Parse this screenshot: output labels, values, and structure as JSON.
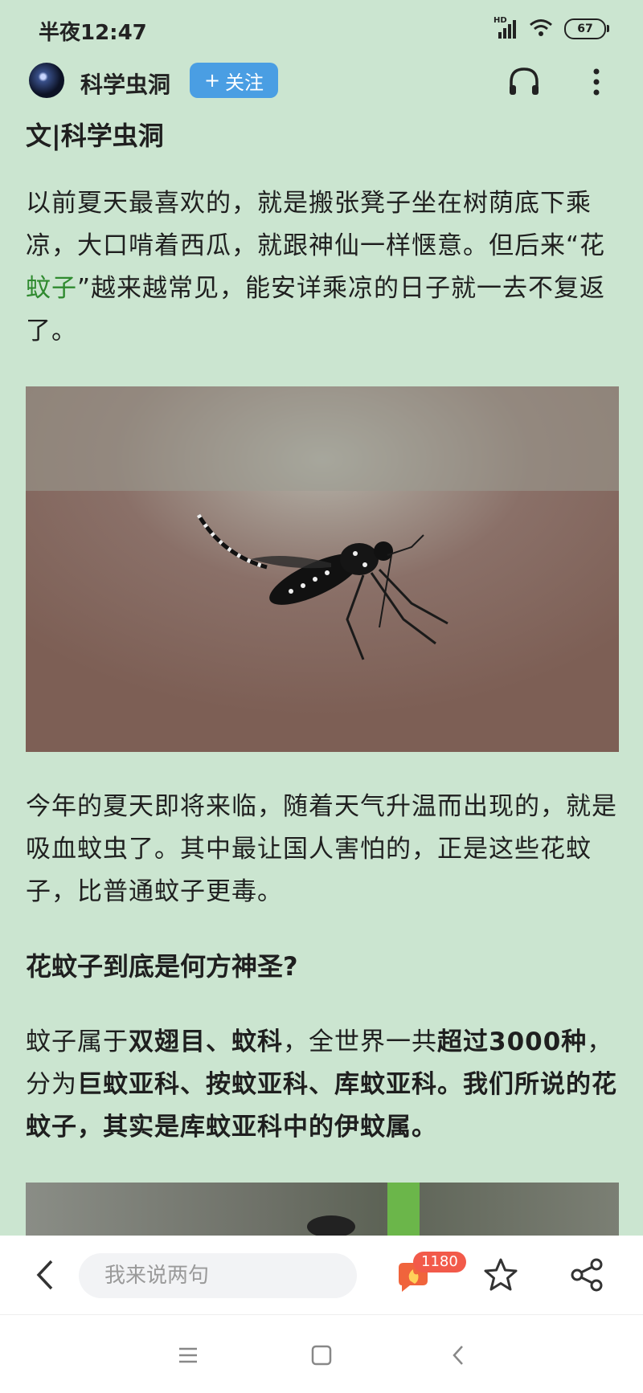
{
  "status_bar": {
    "time": "半夜12:47",
    "signal_label": "HD",
    "battery": "67",
    "icons": [
      "signal-icon",
      "wifi-icon",
      "battery-icon"
    ]
  },
  "header": {
    "author": "科学虫洞",
    "follow_label": "关注",
    "follow_symbol": "+",
    "icons": [
      "headphones-icon",
      "more-icon"
    ]
  },
  "article": {
    "byline": "文|科学虫洞",
    "para1_a": "以前夏天最喜欢的，就是搬张凳子坐在树荫底下乘凉，大口啃着西瓜，就跟神仙一样惬意。但后来“花",
    "para1_link": "蚊子",
    "para1_b": "”越来越常见，能安详乘凉的日子就一去不复返了。",
    "para2": "今年的夏天即将来临，随着天气升温而出现的，就是吸血蚊虫了。其中最让国人害怕的，正是这些花蚊子，比普通蚊子更毒。",
    "subhead": "花蚊子到底是何方神圣?",
    "para3_1": "蚊子属于",
    "para3_2": "双翅目、蚊科",
    "para3_3": "，全世界一共",
    "para3_4": "超过3000种",
    "para3_5": "，分为",
    "para3_6": "巨蚊亚科、按蚊亚科、库蚊亚科。我们所说的花蚊子，其实是库蚊亚科中的伊蚊属。"
  },
  "action_bar": {
    "comment_placeholder": "我来说两句",
    "comment_count": "1180",
    "icons": [
      "back-icon",
      "comment-icon",
      "star-icon",
      "share-icon"
    ]
  },
  "nav_bar": {
    "icons": [
      "menu-icon",
      "home-icon",
      "back-nav-icon"
    ]
  },
  "colors": {
    "background": "#cbe5d0",
    "follow_button": "#4a9ee3",
    "link_text": "#2f8a2f",
    "badge": "#f25a4a"
  }
}
